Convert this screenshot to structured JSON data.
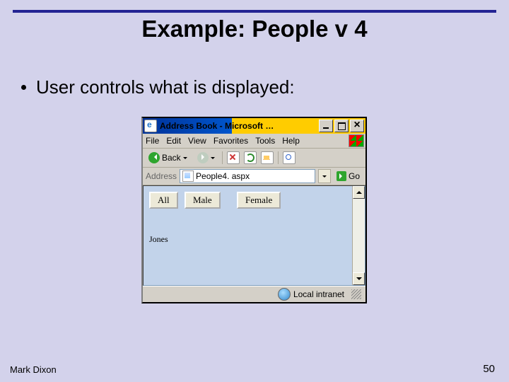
{
  "slide": {
    "title": "Example: People v 4",
    "bullet": "User controls what is displayed:",
    "author": "Mark Dixon",
    "page_number": "50"
  },
  "window": {
    "title": "Address Book - Microsoft …",
    "menu": {
      "file": "File",
      "edit": "Edit",
      "view": "View",
      "favorites": "Favorites",
      "tools": "Tools",
      "help": "Help"
    },
    "toolbar": {
      "back": "Back"
    },
    "address": {
      "label": "Address",
      "value": "People4. aspx",
      "go": "Go"
    },
    "filters": {
      "all": "All",
      "male": "Male",
      "female": "Female"
    },
    "results": {
      "r0": "Jones"
    },
    "status": {
      "zone": "Local intranet"
    }
  }
}
